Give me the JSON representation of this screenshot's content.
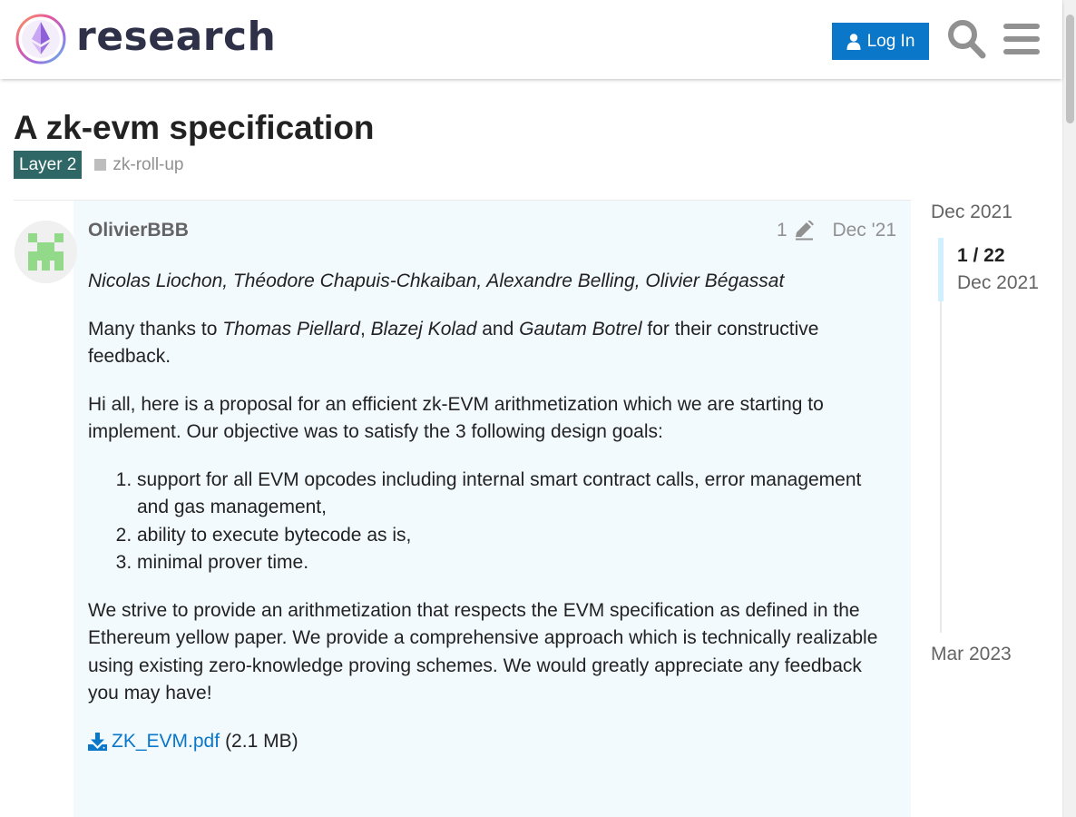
{
  "header": {
    "site_name": "research",
    "login_label": "Log In",
    "login_icon": "user-icon",
    "search_icon": "search-icon",
    "menu_icon": "hamburger-menu-icon"
  },
  "topic": {
    "title": "A zk-evm specification",
    "category": "Layer 2",
    "tag": "zk-roll-up"
  },
  "post": {
    "username": "OlivierBBB",
    "edit_count": "1",
    "date": "Dec '21",
    "authors": "Nicolas Liochon, Théodore Chapuis-Chkaiban, Alexandre Belling, Olivier Bégassat",
    "thanks_prefix": "Many thanks to ",
    "thanks_name1": "Thomas Piellard",
    "thanks_sep1": ", ",
    "thanks_name2": "Blazej Kolad",
    "thanks_and": " and ",
    "thanks_name3": "Gautam Botrel",
    "thanks_suffix": " for their constructive feedback.",
    "intro": "Hi all, here is a proposal for an efficient zk-EVM arithmetization which we are starting to implement. Our objective was to satisfy the 3 following design goals:",
    "goals": [
      "support for all EVM opcodes including internal smart contract calls, error management and gas management,",
      "ability to execute bytecode as is,",
      "minimal prover time."
    ],
    "closing": "We strive to provide an arithmetization that respects the EVM specification as defined in the Ethereum yellow paper. We provide a comprehensive approach which is technically realizable using existing zero-knowledge proving schemes. We would greatly appreciate any feedback you may have!",
    "attachment_name": "ZK_EVM.pdf",
    "attachment_size": "(2.1 MB)"
  },
  "timeline": {
    "start": "Dec 2021",
    "position": "1 / 22",
    "position_date": "Dec 2021",
    "end": "Mar 2023"
  },
  "colors": {
    "accent": "#0a77c9",
    "category": "#2f6767",
    "post_bg": "#f2fafe"
  }
}
